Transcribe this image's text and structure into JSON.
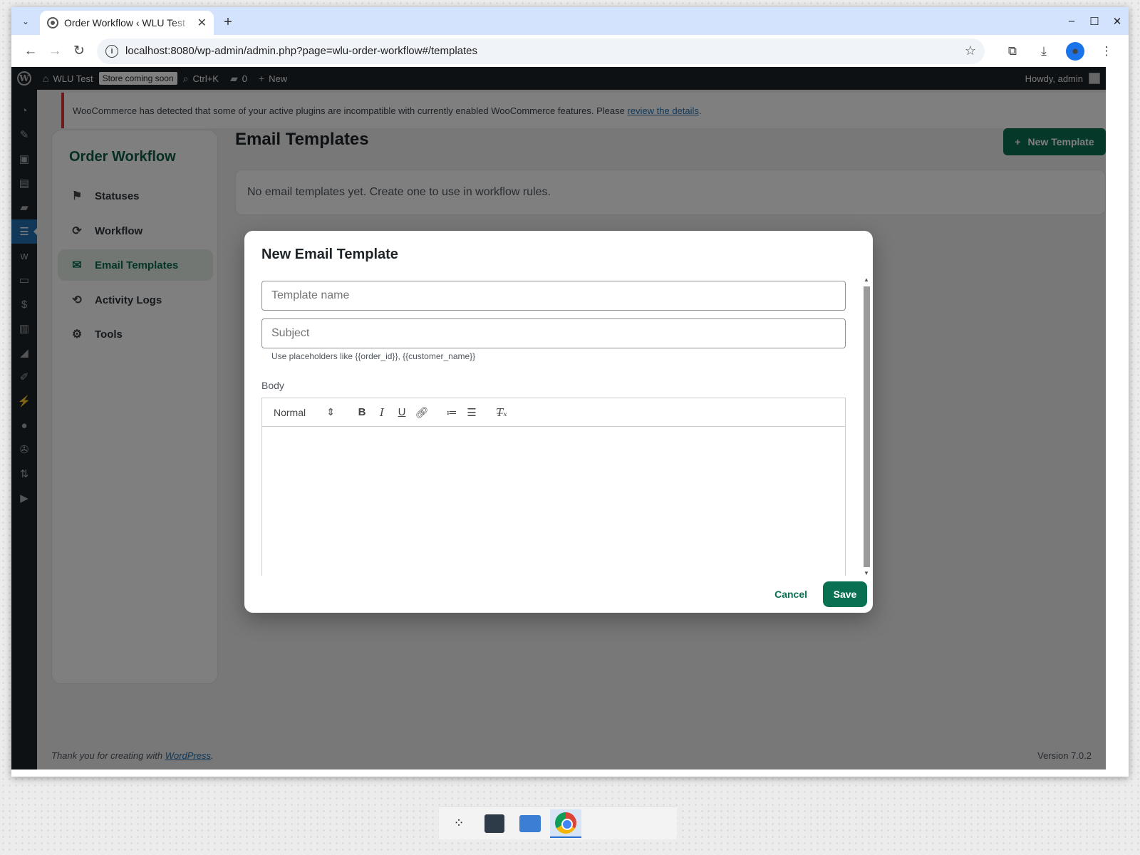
{
  "browser": {
    "tab_title": "Order Workflow ‹ WLU Test",
    "url": "localhost:8080/wp-admin/admin.php?page=wlu-order-workflow#/templates"
  },
  "adminbar": {
    "site_name": "WLU Test",
    "store_badge": "Store coming soon",
    "search_shortcut": "Ctrl+K",
    "comments_count": "0",
    "new_label": "New",
    "howdy": "Howdy, admin"
  },
  "notice": {
    "text": "WooCommerce has detected that some of your active plugins are incompatible with currently enabled WooCommerce features. Please ",
    "link": "review the details",
    "suffix": "."
  },
  "plugin": {
    "brand": "Order Workflow",
    "nav": [
      {
        "label": "Statuses",
        "icon": "flag-icon"
      },
      {
        "label": "Workflow",
        "icon": "workflow-icon"
      },
      {
        "label": "Email Templates",
        "icon": "envelope-icon"
      },
      {
        "label": "Activity Logs",
        "icon": "history-icon"
      },
      {
        "label": "Tools",
        "icon": "gear-icon"
      }
    ],
    "active_nav": "Email Templates"
  },
  "page": {
    "title": "Email Templates",
    "new_button": "New Template",
    "empty_text": "No email templates yet. Create one to use in workflow rules."
  },
  "modal": {
    "title": "New Email Template",
    "name_placeholder": "Template name",
    "subject_placeholder": "Subject",
    "hint": "Use placeholders like {{order_id}}, {{customer_name}}",
    "body_label": "Body",
    "format_select": "Normal",
    "cancel": "Cancel",
    "save": "Save"
  },
  "footer": {
    "thanks_prefix": "Thank you for creating with ",
    "thanks_link": "WordPress",
    "thanks_suffix": ".",
    "version": "Version 7.0.2"
  },
  "colors": {
    "accent": "#0a7052",
    "admin_bar": "#1d2327",
    "notice_border": "#d63638"
  }
}
